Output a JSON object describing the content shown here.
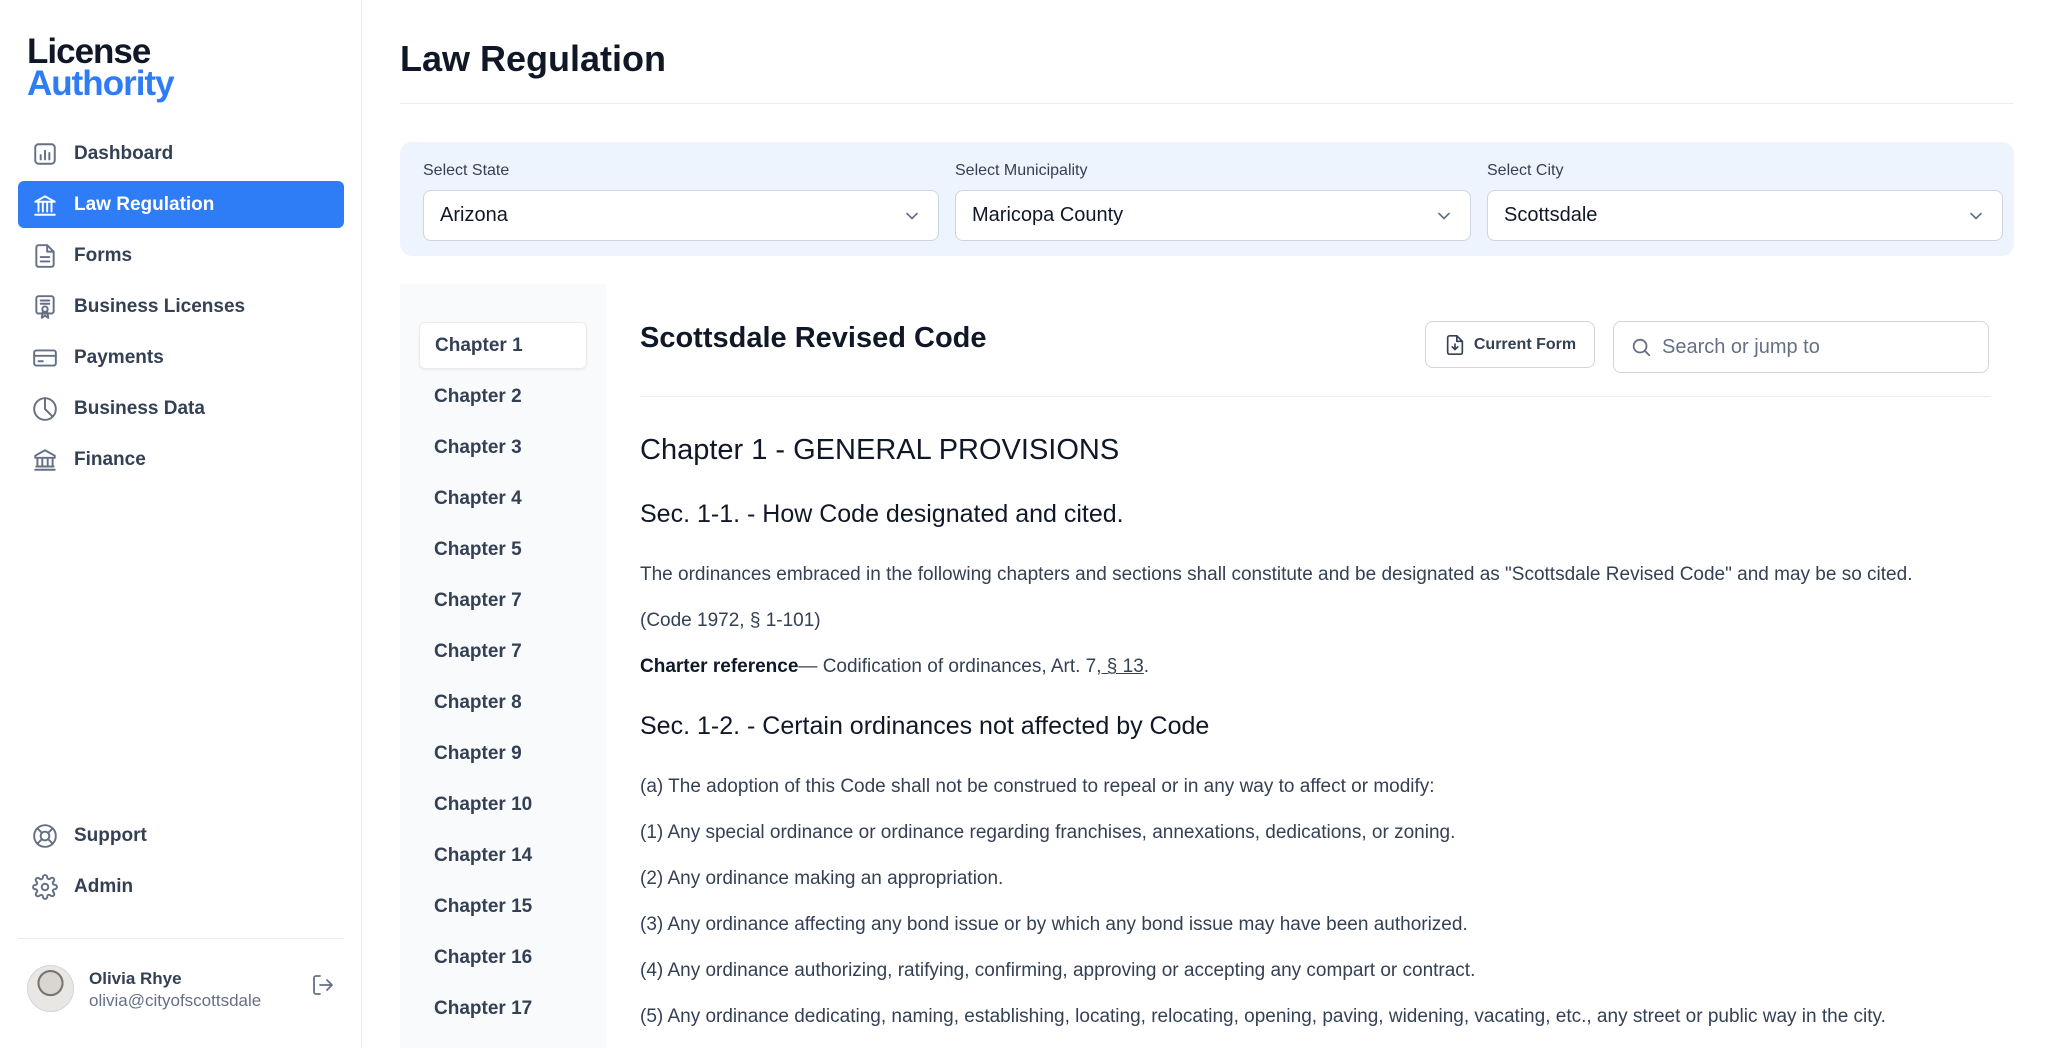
{
  "brand": {
    "line1": "License",
    "line2": "Authority"
  },
  "sidebar": {
    "items": [
      {
        "label": "Dashboard",
        "icon": "dashboard-icon"
      },
      {
        "label": "Law Regulation",
        "icon": "bank-icon",
        "active": true
      },
      {
        "label": "Forms",
        "icon": "document-icon"
      },
      {
        "label": "Business Licenses",
        "icon": "certificate-icon"
      },
      {
        "label": "Payments",
        "icon": "credit-card-icon"
      },
      {
        "label": "Business Data",
        "icon": "pie-chart-icon"
      },
      {
        "label": "Finance",
        "icon": "building-columns-icon"
      }
    ],
    "bottom_items": [
      {
        "label": "Support",
        "icon": "lifebuoy-icon"
      },
      {
        "label": "Admin",
        "icon": "gear-icon"
      }
    ],
    "user": {
      "name": "Olivia Rhye",
      "email": "olivia@cityofscottsdale"
    }
  },
  "page": {
    "title": "Law Regulation"
  },
  "filters": {
    "state": {
      "label": "Select State",
      "value": "Arizona"
    },
    "municipality": {
      "label": "Select Municipality",
      "value": "Maricopa County"
    },
    "city": {
      "label": "Select City",
      "value": "Scottsdale"
    }
  },
  "chapters": [
    "Chapter 1",
    "Chapter 2",
    "Chapter 3",
    "Chapter 4",
    "Chapter 5",
    "Chapter 7",
    "Chapter 7",
    "Chapter 8",
    "Chapter 9",
    "Chapter 10",
    "Chapter 14",
    "Chapter 15",
    "Chapter 16",
    "Chapter 17"
  ],
  "document": {
    "title": "Scottsdale Revised Code",
    "current_form_label": "Current Form",
    "search_placeholder": "Search or jump to",
    "chapter_heading": "Chapter 1 - GENERAL PROVISIONS",
    "sec1": {
      "heading": "Sec. 1-1. - How Code designated and cited.",
      "body": "The ordinances embraced in the following chapters and sections shall constitute and be designated as \"Scottsdale Revised Code\" and may be so cited.",
      "citation": "(Code 1972, § 1-101)",
      "charter_label": "Charter reference",
      "charter_text": "— Codification of ordinances, Art. 7,",
      "charter_link": " § 13",
      "charter_end": "."
    },
    "sec2": {
      "heading": "Sec. 1-2. - Certain ordinances not affected by Code",
      "items": [
        "(a) The adoption of this Code shall not be construed to repeal or in any way to affect or modify:",
        "(1) Any special ordinance or ordinance regarding franchises, annexations, dedications, or zoning.",
        "(2) Any ordinance making an appropriation.",
        "(3) Any ordinance affecting any bond issue or by which any bond issue may have been authorized.",
        "(4) Any ordinance authorizing, ratifying, confirming, approving or accepting any compart or contract.",
        "(5) Any ordinance dedicating, naming, establishing, locating, relocating, opening, paving, widening, vacating, etc., any street or public way in the city."
      ]
    }
  },
  "colors": {
    "accent": "#2e7cf6",
    "filter_bg": "#eef4fd"
  }
}
